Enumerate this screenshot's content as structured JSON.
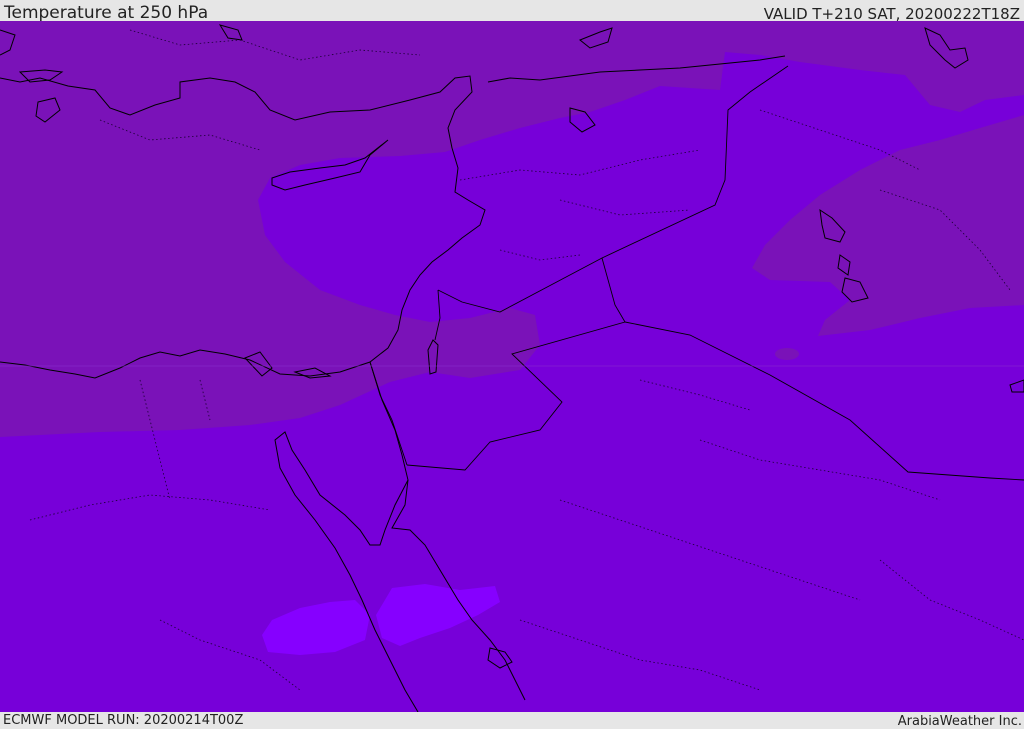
{
  "header": {
    "title": "Temperature at 250 hPa",
    "valid_time": "VALID T+210 SAT, 20200222T18Z"
  },
  "footer": {
    "model_run": "ECMWF MODEL RUN: 20200214T00Z",
    "credit": "ArabiaWeather Inc."
  },
  "map": {
    "parameter": "temperature",
    "level_hpa": 250,
    "colors": {
      "background": "#7700d9",
      "warmer_band": "#7a12b8",
      "colder_patch": "#8600ff",
      "coastline": "#000000"
    }
  }
}
